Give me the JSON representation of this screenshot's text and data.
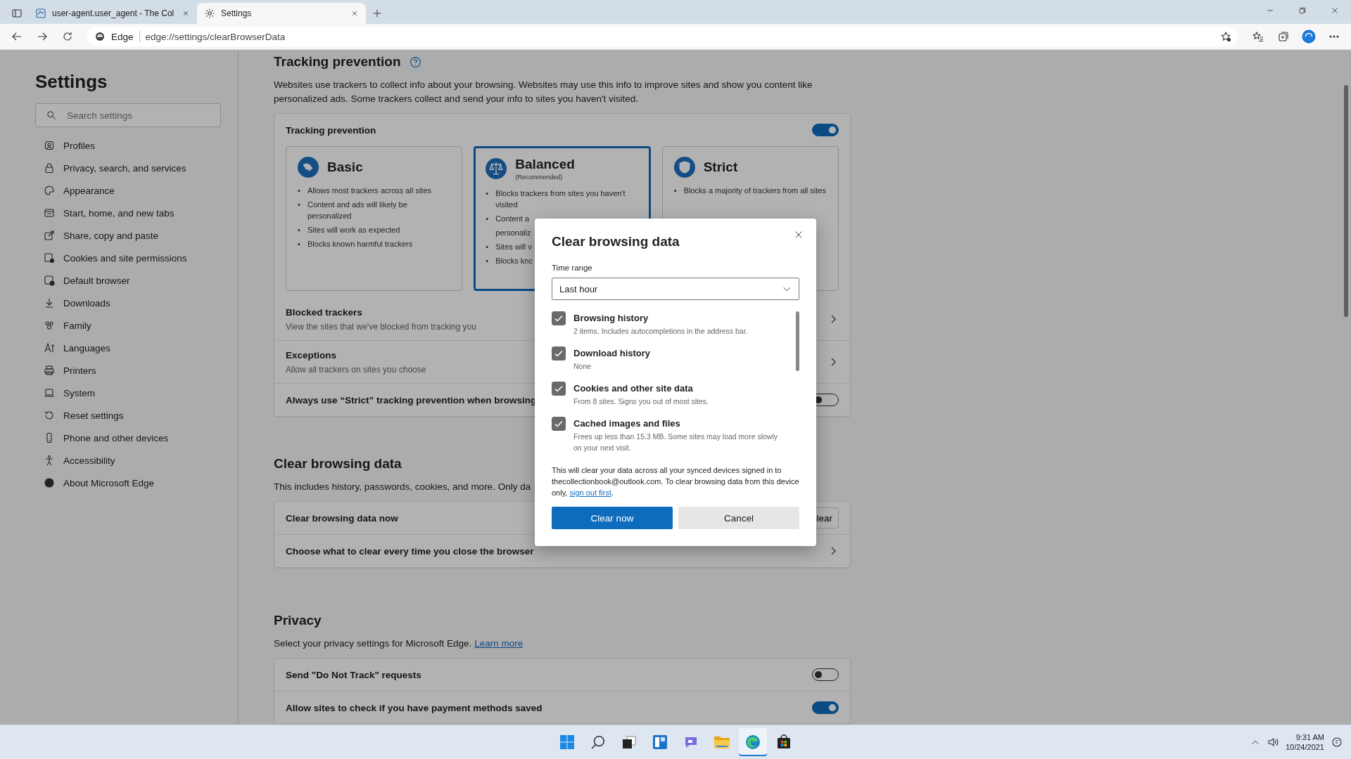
{
  "browser": {
    "tabs": [
      {
        "title": "user-agent.user_agent - The Col",
        "selected": false,
        "kind": "page"
      },
      {
        "title": "Settings",
        "selected": true,
        "kind": "settings"
      }
    ],
    "address": {
      "label": "Edge",
      "url": "edge://settings/clearBrowserData"
    }
  },
  "sidebar": {
    "title": "Settings",
    "search": {
      "placeholder": "Search settings"
    },
    "items": [
      {
        "label": "Profiles"
      },
      {
        "label": "Privacy, search, and services"
      },
      {
        "label": "Appearance"
      },
      {
        "label": "Start, home, and new tabs"
      },
      {
        "label": "Share, copy and paste"
      },
      {
        "label": "Cookies and site permissions"
      },
      {
        "label": "Default browser"
      },
      {
        "label": "Downloads"
      },
      {
        "label": "Family"
      },
      {
        "label": "Languages"
      },
      {
        "label": "Printers"
      },
      {
        "label": "System"
      },
      {
        "label": "Reset settings"
      },
      {
        "label": "Phone and other devices"
      },
      {
        "label": "Accessibility"
      },
      {
        "label": "About Microsoft Edge"
      }
    ]
  },
  "tracking": {
    "title": "Tracking prevention",
    "description": "Websites use trackers to collect info about your browsing. Websites may use this info to improve sites and show you content like personalized ads. Some trackers collect and send your info to sites you haven't visited.",
    "card_title": "Tracking prevention",
    "on": true,
    "options": [
      {
        "title": "Basic",
        "kind": "basic",
        "selected": false,
        "bullets": [
          {
            "mark": "•",
            "text": "Allows most trackers across all sites"
          },
          {
            "mark": "•",
            "text": "Content and ads will likely be personalized"
          },
          {
            "mark": "•",
            "text": "Sites will work as expected"
          },
          {
            "mark": "•",
            "text": "Blocks known harmful trackers"
          }
        ]
      },
      {
        "title": "Balanced",
        "subtitle": "(Recommended)",
        "kind": "balanced",
        "selected": true,
        "bullets": [
          {
            "mark": "•",
            "text": "Blocks trackers from sites you haven't visited"
          },
          {
            "mark": "•",
            "text": "Content a"
          },
          {
            "text": "personaliz"
          },
          {
            "mark": "•",
            "text": "Sites will v"
          },
          {
            "mark": "•",
            "text": "Blocks knc"
          }
        ]
      },
      {
        "title": "Strict",
        "kind": "strict",
        "selected": false,
        "bullets": [
          {
            "mark": "•",
            "text": "Blocks a majority of trackers from all sites"
          }
        ]
      }
    ],
    "rows": [
      {
        "kind": "link",
        "title": "Blocked trackers",
        "detail": "View the sites that we've blocked from tracking you"
      },
      {
        "kind": "link",
        "title": "Exceptions",
        "detail": "Allow all trackers on sites you choose"
      },
      {
        "kind": "toggle",
        "title": "Always use “Strict” tracking prevention when browsing",
        "on": false
      }
    ]
  },
  "clear_data": {
    "title": "Clear browsing data",
    "description": "This includes history, passwords, cookies, and more. Only da",
    "rows": [
      {
        "kind": "button",
        "title": "Clear browsing data now",
        "button": "lear"
      },
      {
        "kind": "link",
        "title": "Choose what to clear every time you close the browser"
      }
    ]
  },
  "privacy": {
    "title": "Privacy",
    "description": "Select your privacy settings for Microsoft Edge.",
    "link": "Learn more",
    "rows": [
      {
        "kind": "toggle",
        "title": "Send \"Do Not Track\" requests",
        "on": false
      },
      {
        "kind": "toggle",
        "title": "Allow sites to check if you have payment methods saved",
        "on": true
      }
    ]
  },
  "dialog": {
    "title": "Clear browsing data",
    "time_range": {
      "label": "Time range",
      "value": "Last hour"
    },
    "options": [
      {
        "label": "Browsing history",
        "detail": "2 items. Includes autocompletions in the address bar.",
        "checked": true
      },
      {
        "label": "Download history",
        "detail": "None",
        "checked": true
      },
      {
        "label": "Cookies and other site data",
        "detail": "From 8 sites. Signs you out of most sites.",
        "checked": true
      },
      {
        "label": "Cached images and files",
        "detail": "Frees up less than 15.3 MB. Some sites may load more slowly on your next visit.",
        "checked": true
      }
    ],
    "note": "This will clear your data across all your synced devices signed in to thecollectionbook@outlook.com. To clear browsing data from this device only,",
    "note_link": "sign out first",
    "note_end": ".",
    "primary": "Clear now",
    "secondary": "Cancel"
  },
  "taskbar": {
    "time": "9:31 AM",
    "date": "10/24/2021"
  }
}
